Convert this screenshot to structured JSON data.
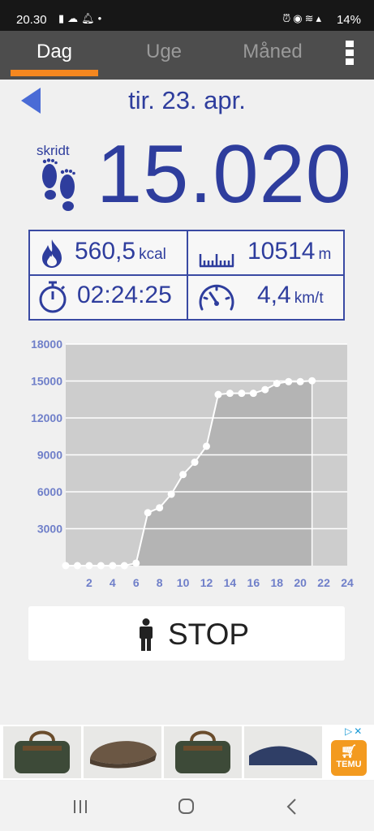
{
  "status_bar": {
    "time": "20.30",
    "battery": "14%",
    "left_icons": [
      "storage-icon",
      "cloud-icon",
      "bell-icon",
      "dot-icon"
    ],
    "right_icons": [
      "alarm-icon",
      "alarm-clock-icon",
      "wifi-icon",
      "signal-icon"
    ]
  },
  "tabs": [
    {
      "label": "Dag",
      "active": true
    },
    {
      "label": "Uge",
      "active": false
    },
    {
      "label": "Måned",
      "active": false
    }
  ],
  "date_label": "tir. 23. apr.",
  "steps": {
    "label": "skridt",
    "value": "15.020"
  },
  "stats": {
    "calories": {
      "value": "560,5",
      "unit": "kcal"
    },
    "distance": {
      "value": "10514",
      "unit": "m"
    },
    "duration": {
      "value": "02:24:25"
    },
    "speed": {
      "value": "4,4",
      "unit": "km/t"
    }
  },
  "chart_data": {
    "type": "area",
    "x": [
      0,
      1,
      2,
      3,
      4,
      5,
      6,
      7,
      8,
      9,
      10,
      11,
      12,
      13,
      14,
      15,
      16,
      17,
      18,
      19,
      20,
      21
    ],
    "y": [
      0,
      0,
      0,
      0,
      0,
      0,
      200,
      4300,
      4700,
      5800,
      7400,
      8400,
      9700,
      13900,
      14000,
      14000,
      14000,
      14300,
      14800,
      14950,
      14950,
      15020
    ],
    "xticks": [
      2,
      4,
      6,
      8,
      10,
      12,
      14,
      16,
      18,
      20,
      22,
      24
    ],
    "yticks": [
      3000,
      6000,
      9000,
      12000,
      15000,
      18000
    ],
    "xlim": [
      0,
      24
    ],
    "ylim": [
      0,
      18000
    ],
    "grid": true,
    "colors": {
      "plot_bg": "#cdcdcd",
      "fill": "#b4b4b4",
      "line": "#ffffff",
      "tick": "#6f7fc9"
    }
  },
  "stop_button": {
    "label": "STOP"
  },
  "ad": {
    "choices_label": "▷✕",
    "brand": "TEMU",
    "items": [
      "duffel-bag",
      "flat-cap",
      "duffel-bag",
      "slip-on-shoe"
    ]
  },
  "colors": {
    "accent": "#f5871f",
    "primary": "#2e3d9d",
    "tab_bg": "#4d4d4d"
  }
}
